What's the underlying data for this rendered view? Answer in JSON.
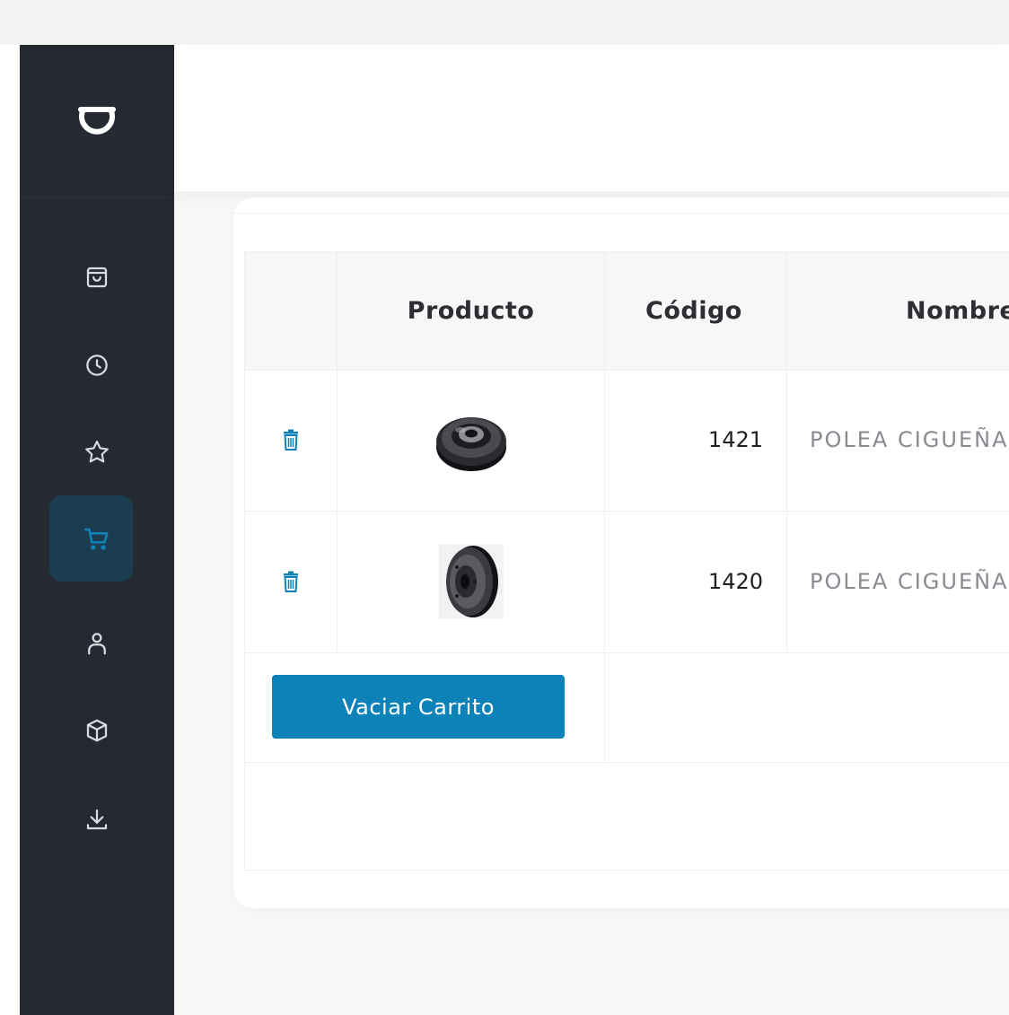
{
  "sidebar": {
    "logo": "brand-logo",
    "items": [
      {
        "icon": "shopping-bag-icon",
        "active": false
      },
      {
        "icon": "clock-icon",
        "active": false
      },
      {
        "icon": "star-icon",
        "active": false
      },
      {
        "icon": "cart-icon",
        "active": true
      },
      {
        "icon": "user-icon",
        "active": false
      },
      {
        "icon": "box-icon",
        "active": false
      },
      {
        "icon": "download-icon",
        "active": false
      }
    ]
  },
  "colors": {
    "sidebar_bg": "#252932",
    "active_bg": "#1c3c4f",
    "accent": "#0c82b8"
  },
  "table": {
    "headers": {
      "actions": "",
      "product": "Producto",
      "code": "Código",
      "name": "Nombre"
    },
    "rows": [
      {
        "code": "1421",
        "name": "POLEA CIGUEÑAL"
      },
      {
        "code": "1420",
        "name": "POLEA CIGUEÑAL"
      }
    ]
  },
  "actions": {
    "clear_cart_label": "Vaciar Carrito"
  }
}
